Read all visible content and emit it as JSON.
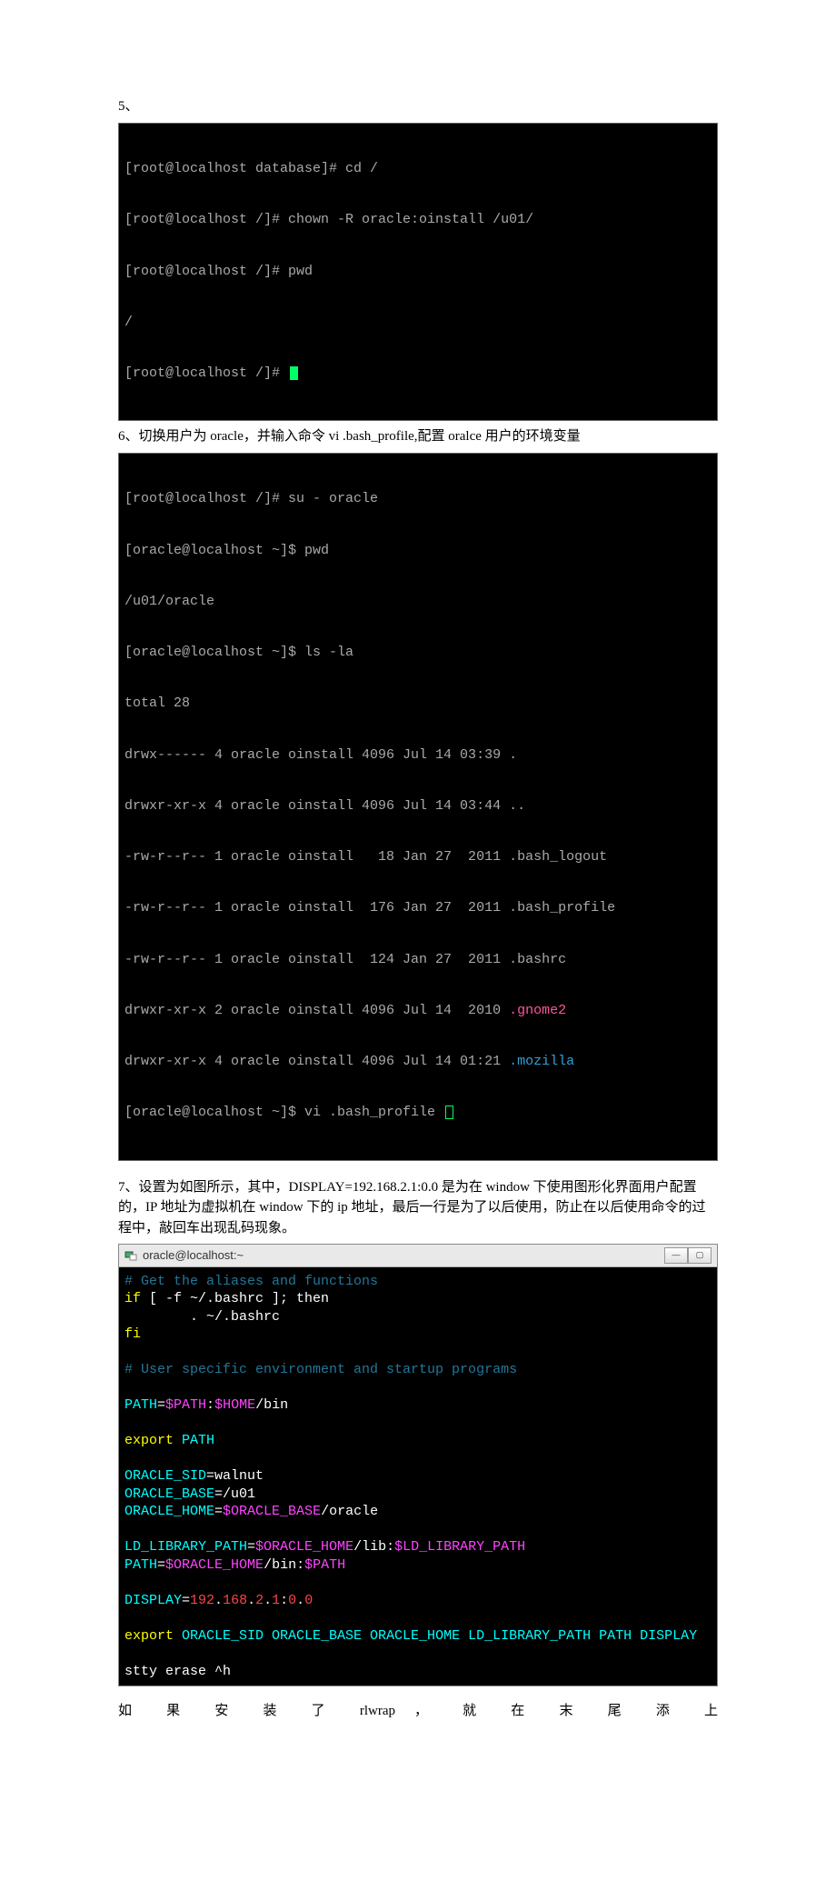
{
  "text": {
    "s5_label": "5、",
    "s6_label": "6、切换用户为 oracle，并输入命令 vi   .bash_profile,配置 oralce 用户的环境变量",
    "s7_label": "7、设置为如图所示，其中，DISPLAY=192.168.2.1:0.0 是为在 window 下使用图形化界面用户配置的，IP 地址为虚拟机在 window 下的 ip 地址，最后一行是为了以后使用，防止在以后使用命令的过程中，敲回车出现乱码现象。",
    "footer": "如 果 安 装 了 rlwrap ， 就 在 末 尾 添 上"
  },
  "term1": {
    "l1": "[root@localhost database]# cd /",
    "l2": "[root@localhost /]# chown -R oracle:oinstall /u01/",
    "l3": "[root@localhost /]# pwd",
    "l4": "/",
    "l5": "[root@localhost /]# "
  },
  "term2": {
    "l1": "[root@localhost /]# su - oracle",
    "l2": "[oracle@localhost ~]$ pwd",
    "l3": "/u01/oracle",
    "l4": "[oracle@localhost ~]$ ls -la",
    "l5": "total 28",
    "l6": "drwx------ 4 oracle oinstall 4096 Jul 14 03:39 .",
    "l7": "drwxr-xr-x 4 oracle oinstall 4096 Jul 14 03:44 ..",
    "l8": "-rw-r--r-- 1 oracle oinstall   18 Jan 27  2011 .bash_logout",
    "l9": "-rw-r--r-- 1 oracle oinstall  176 Jan 27  2011 .bash_profile",
    "l10": "-rw-r--r-- 1 oracle oinstall  124 Jan 27  2011 .bashrc",
    "l11a": "drwxr-xr-x 2 oracle oinstall 4096 Jul 14  2010 ",
    "l11b": ".gnome2",
    "l12a": "drwxr-xr-x 4 oracle oinstall 4096 Jul 14 01:21 ",
    "l12b": ".mozilla",
    "l13": "[oracle@localhost ~]$ vi .bash_profile "
  },
  "putty": {
    "title": "oracle@localhost:~",
    "lines": {
      "c1": "# Get the aliases and functions",
      "if": "if",
      "if2": " [ -f ~/.bashrc ]; then",
      "dot": "        . ~/.bashrc",
      "fi": "fi",
      "c2": "# User specific environment and startup programs",
      "path_lbl": "PATH",
      "path_eq": "=",
      "path_v1": "$PATH",
      "path_c1": ":",
      "path_v2": "$HOME",
      "path_v3": "/bin",
      "export": "export",
      "export_path": " PATH",
      "sid_lbl": "ORACLE_SID",
      "sid_val": "=walnut",
      "base_lbl": "ORACLE_BASE",
      "base_val": "=/u01",
      "home_lbl": "ORACLE_HOME",
      "home_eq": "=",
      "home_var": "$ORACLE_BASE",
      "home_suf": "/oracle",
      "ld_lbl": "LD_LIBRARY_PATH",
      "ld_eq": "=",
      "ld_v1": "$ORACLE_HOME",
      "ld_s1": "/lib:",
      "ld_v2": "$LD_LIBRARY_PATH",
      "p2_lbl": "PATH",
      "p2_eq": "=",
      "p2_v1": "$ORACLE_HOME",
      "p2_s1": "/bin:",
      "p2_v2": "$PATH",
      "disp_lbl": "DISPLAY",
      "disp_eq": "=",
      "disp_ip1": "192",
      "disp_d": ".",
      "disp_ip2": "168",
      "disp_ip3": "2",
      "disp_ip4": "1",
      "disp_c": ":",
      "disp_p1": "0",
      "disp_p2": "0",
      "export2": "export",
      "export2_vars": " ORACLE_SID ORACLE_BASE ORACLE_HOME LD_LIBRARY_PATH PATH DISPLAY",
      "stty": "stty erase ^h"
    }
  }
}
